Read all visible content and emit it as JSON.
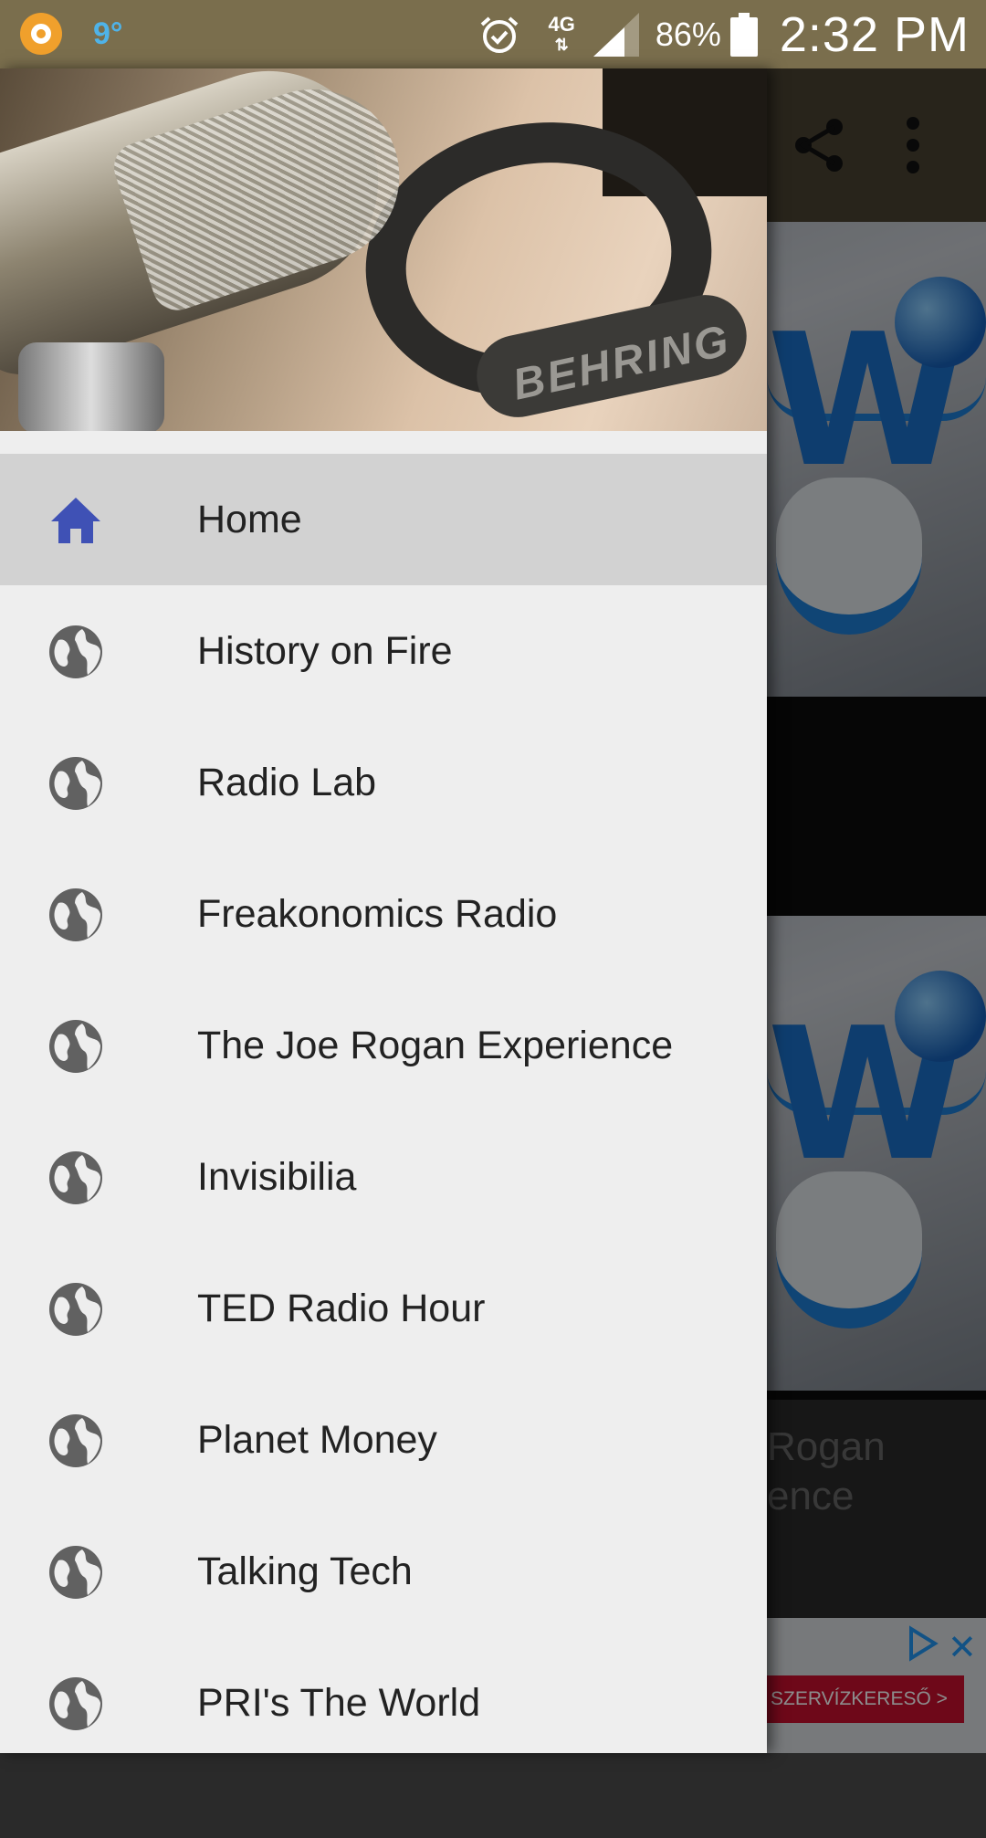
{
  "status_bar": {
    "temperature": "9°",
    "network": "4G",
    "battery": "86%",
    "time": "2:32 PM"
  },
  "background_app": {
    "card_title_line1": "Rogan",
    "card_title_line2": "ence",
    "ad_button": "SZERVÍZKERESŐ  >",
    "ad_close": "✕"
  },
  "drawer": {
    "header_brand": "BEHRING",
    "items": [
      {
        "label": "Home",
        "icon": "home-icon",
        "active": true
      },
      {
        "label": "History on Fire",
        "icon": "globe-icon"
      },
      {
        "label": "Radio Lab",
        "icon": "globe-icon"
      },
      {
        "label": "Freakonomics Radio",
        "icon": "globe-icon"
      },
      {
        "label": "The Joe Rogan Experience",
        "icon": "globe-icon"
      },
      {
        "label": "Invisibilia",
        "icon": "globe-icon"
      },
      {
        "label": "TED Radio Hour",
        "icon": "globe-icon"
      },
      {
        "label": "Planet Money",
        "icon": "globe-icon"
      },
      {
        "label": "Talking Tech",
        "icon": "globe-icon"
      },
      {
        "label": "PRI's The World",
        "icon": "globe-icon"
      }
    ]
  },
  "colors": {
    "status_bar": "#7a6e4d",
    "home_icon": "#3f51b5",
    "globe_icon": "#616161",
    "active_item_bg": "#d2d2d2",
    "drawer_bg": "#eeeeee"
  }
}
